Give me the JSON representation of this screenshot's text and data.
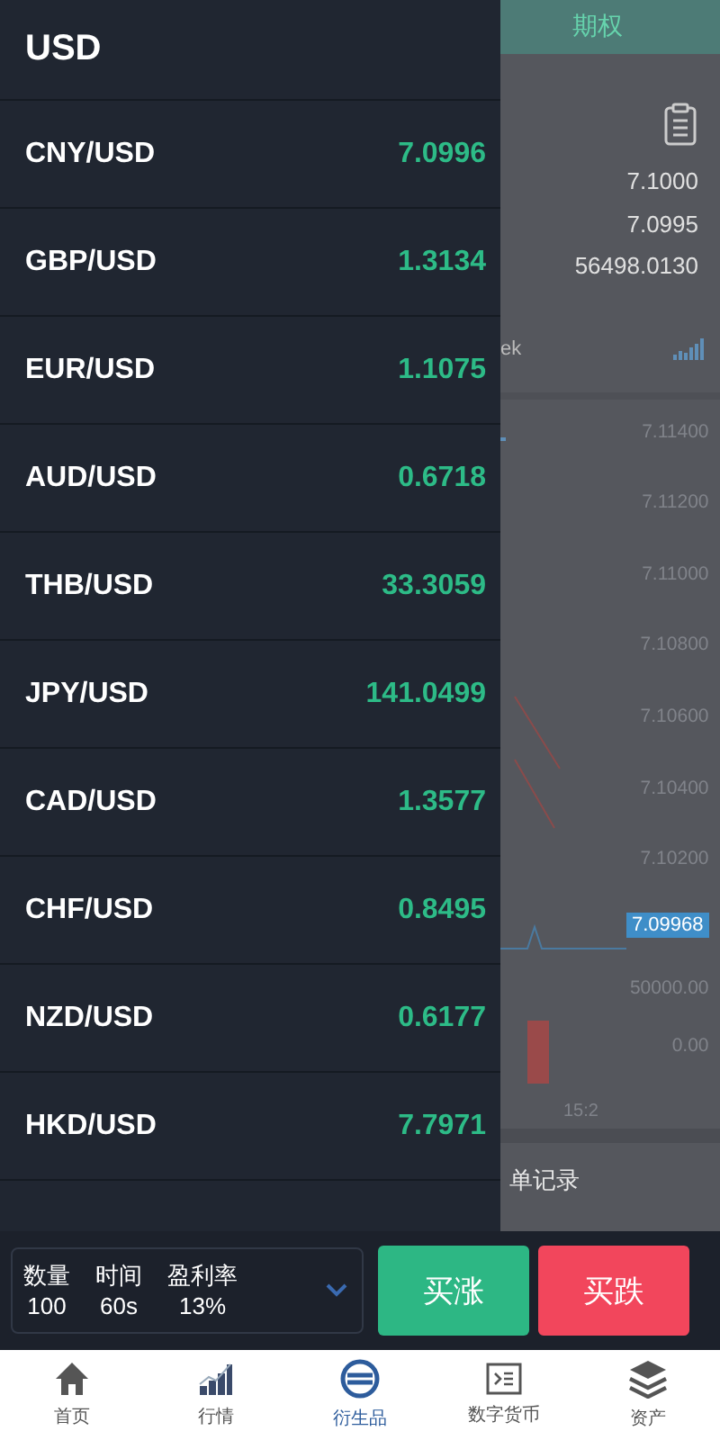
{
  "drawer": {
    "title": "USD",
    "pairs": [
      {
        "name": "CNY/USD",
        "price": "7.0996"
      },
      {
        "name": "GBP/USD",
        "price": "1.3134"
      },
      {
        "name": "EUR/USD",
        "price": "1.1075"
      },
      {
        "name": "AUD/USD",
        "price": "0.6718"
      },
      {
        "name": "THB/USD",
        "price": "33.3059"
      },
      {
        "name": "JPY/USD",
        "price": "141.0499"
      },
      {
        "name": "CAD/USD",
        "price": "1.3577"
      },
      {
        "name": "CHF/USD",
        "price": "0.8495"
      },
      {
        "name": "NZD/USD",
        "price": "0.6177"
      },
      {
        "name": "HKD/USD",
        "price": "7.7971"
      }
    ]
  },
  "background": {
    "tab": "期权",
    "prices": [
      "7.1000",
      "7.0995",
      "56498.0130"
    ],
    "period": "ek",
    "axis_labels": [
      "7.11400",
      "7.11200",
      "7.11000",
      "7.10800",
      "7.10600",
      "7.10400",
      "7.10200"
    ],
    "price_tag": "7.09968",
    "volume_labels": [
      "50000.00",
      "0.00"
    ],
    "time_label": "15:2",
    "section_title": "单记录"
  },
  "order": {
    "fields": [
      {
        "label": "数量",
        "value": "100"
      },
      {
        "label": "时间",
        "value": "60s"
      },
      {
        "label": "盈利率",
        "value": "13%"
      }
    ]
  },
  "buttons": [
    {
      "label": "买涨",
      "kind": "buy_up"
    },
    {
      "label": "买跌",
      "kind": "buy_down"
    }
  ],
  "nav": [
    {
      "label": "首页",
      "kind": "home",
      "selected": false
    },
    {
      "label": "行情",
      "kind": "chart",
      "selected": false
    },
    {
      "label": "衍生品",
      "kind": "exchange",
      "selected": true
    },
    {
      "label": "数字货币",
      "kind": "terminal",
      "selected": false
    },
    {
      "label": "资产",
      "kind": "layers",
      "selected": false
    }
  ]
}
